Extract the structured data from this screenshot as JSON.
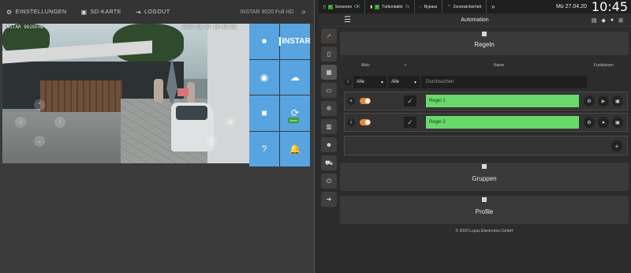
{
  "left": {
    "nav": [
      {
        "icon": "gear-icon",
        "label": "EINSTELLUNGEN"
      },
      {
        "icon": "sd-card-icon",
        "label": "SD-KARTE"
      },
      {
        "icon": "logout-icon",
        "label": "LOGOUT"
      }
    ],
    "model": "INSTAR 9020 Full HD",
    "camera": {
      "label": "INSTAR 9020FHD",
      "timestamp": "2020-04-27 10:46:01"
    },
    "controls": {
      "brand": "INSTAR",
      "badge": "Alarm"
    }
  },
  "right": {
    "statusbar": {
      "items": [
        {
          "label": "Sensoren",
          "value": "OK"
        },
        {
          "label": "Türkontakte",
          "value": "7x"
        },
        {
          "label": "Bypass",
          "value": ""
        },
        {
          "label": "Zonensicherheit",
          "value": ""
        }
      ],
      "date": "Mo 27.04.20",
      "time": "10:45"
    },
    "title": "Automation",
    "sections": {
      "rules": "Regeln",
      "groups": "Gruppen",
      "profiles": "Profile"
    },
    "columns": {
      "active": "Aktiv",
      "name": "Name",
      "functions": "Funktionen"
    },
    "filters": {
      "first": "Alle",
      "second": "Alle",
      "search_placeholder": "Durchsuchen"
    },
    "rules": [
      {
        "name": "Regel 1"
      },
      {
        "name": "Regel 2"
      }
    ],
    "footer": "© 2020 Lupus Electronics GmbH"
  }
}
